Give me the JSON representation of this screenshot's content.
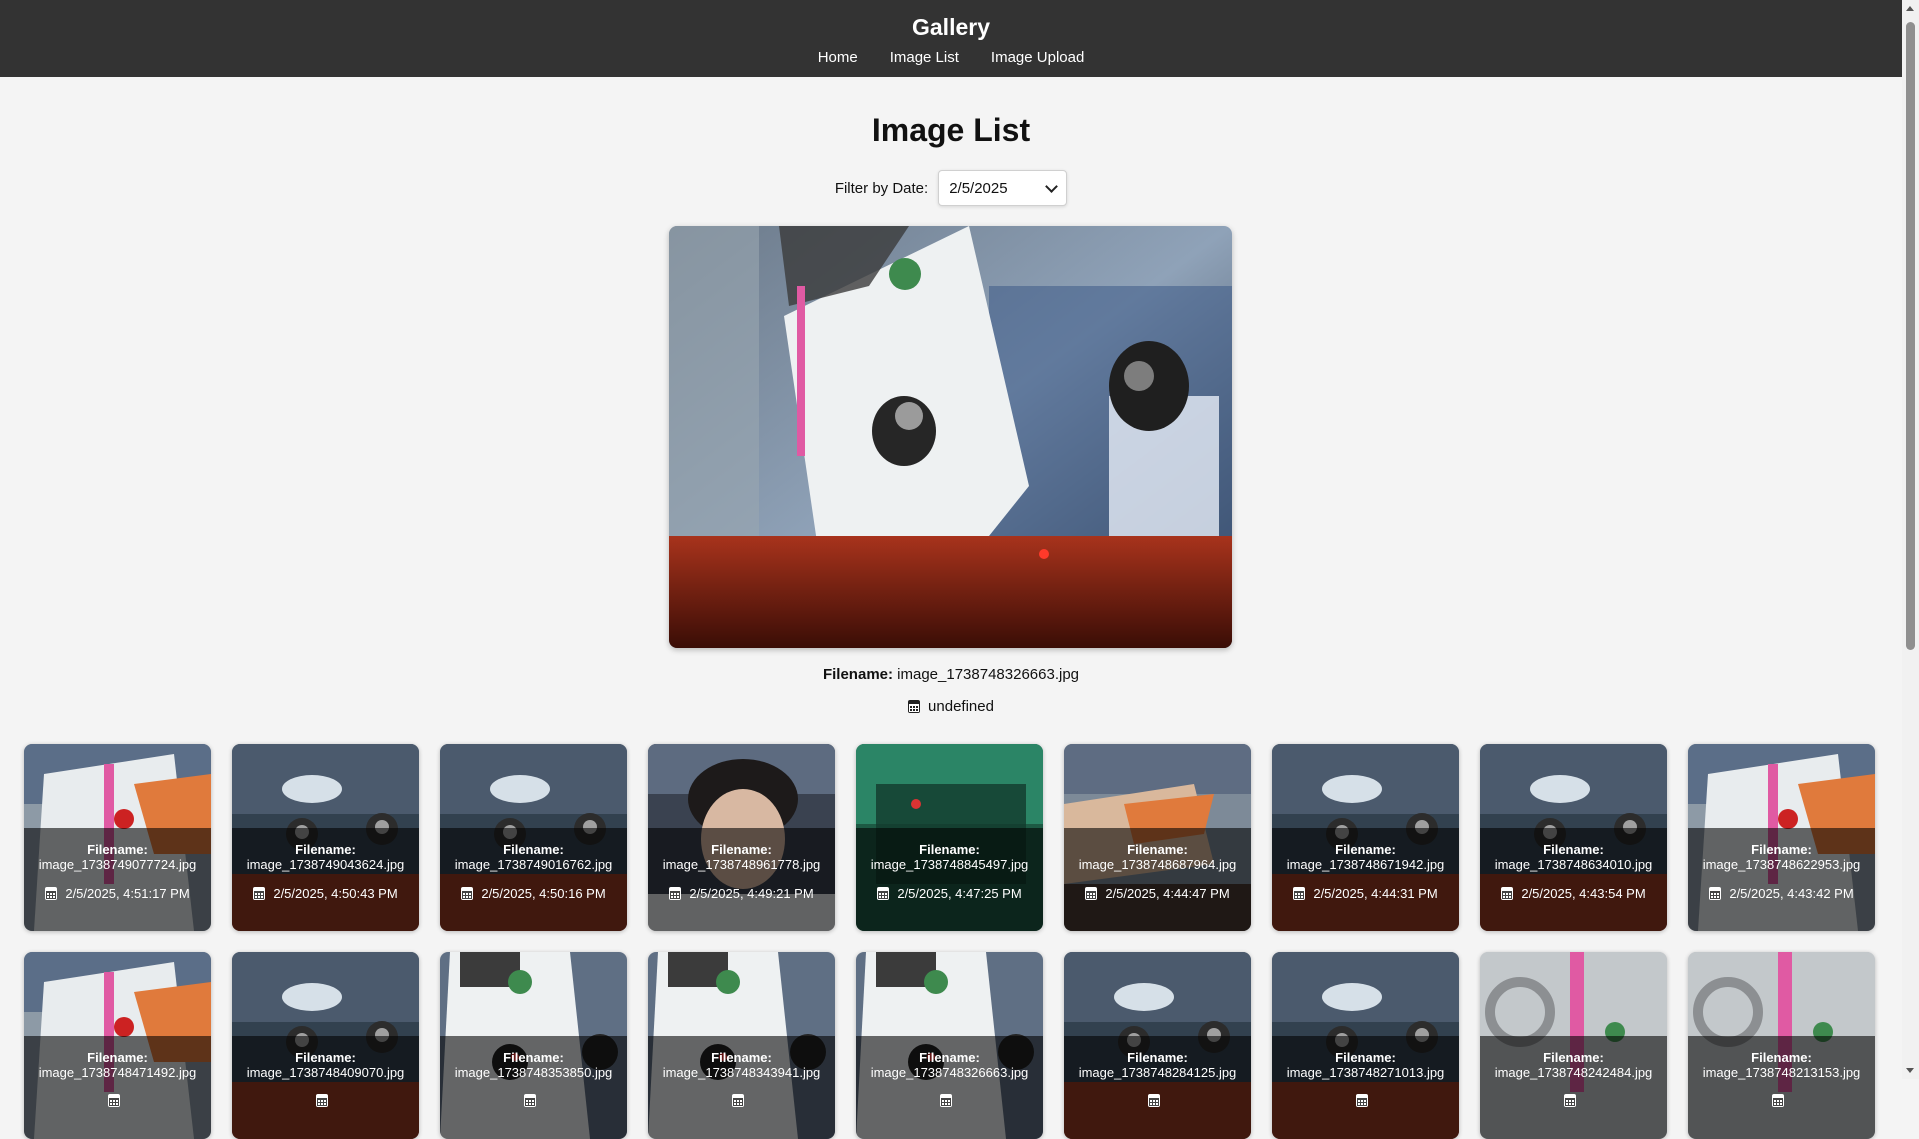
{
  "navbar": {
    "brand": "Gallery",
    "links": [
      {
        "label": "Home"
      },
      {
        "label": "Image List"
      },
      {
        "label": "Image Upload"
      }
    ]
  },
  "page_title": "Image List",
  "filter": {
    "label": "Filter by Date:",
    "selected": "2/5/2025"
  },
  "main_image": {
    "filename_label": "Filename:",
    "filename": "image_1738748326663.jpg",
    "date": "undefined"
  },
  "cards": [
    {
      "filename_label": "Filename:",
      "filename": "image_1738749077724.jpg",
      "date": "2/5/2025, 4:51:17 PM",
      "scene": "person"
    },
    {
      "filename_label": "Filename:",
      "filename": "image_1738749043624.jpg",
      "date": "2/5/2025, 4:50:43 PM",
      "scene": "store"
    },
    {
      "filename_label": "Filename:",
      "filename": "image_1738749016762.jpg",
      "date": "2/5/2025, 4:50:16 PM",
      "scene": "store"
    },
    {
      "filename_label": "Filename:",
      "filename": "image_1738748961778.jpg",
      "date": "2/5/2025, 4:49:21 PM",
      "scene": "face"
    },
    {
      "filename_label": "Filename:",
      "filename": "image_1738748845497.jpg",
      "date": "2/5/2025, 4:47:25 PM",
      "scene": "green"
    },
    {
      "filename_label": "Filename:",
      "filename": "image_1738748687964.jpg",
      "date": "2/5/2025, 4:44:47 PM",
      "scene": "arm"
    },
    {
      "filename_label": "Filename:",
      "filename": "image_1738748671942.jpg",
      "date": "2/5/2025, 4:44:31 PM",
      "scene": "store"
    },
    {
      "filename_label": "Filename:",
      "filename": "image_1738748634010.jpg",
      "date": "2/5/2025, 4:43:54 PM",
      "scene": "store"
    },
    {
      "filename_label": "Filename:",
      "filename": "image_1738748622953.jpg",
      "date": "2/5/2025, 4:43:42 PM",
      "scene": "person"
    },
    {
      "filename_label": "Filename:",
      "filename": "image_1738748471492.jpg",
      "date": "",
      "scene": "person"
    },
    {
      "filename_label": "Filename:",
      "filename": "image_1738748409070.jpg",
      "date": "",
      "scene": "store"
    },
    {
      "filename_label": "Filename:",
      "filename": "image_1738748353850.jpg",
      "date": "",
      "scene": "shirt"
    },
    {
      "filename_label": "Filename:",
      "filename": "image_1738748343941.jpg",
      "date": "",
      "scene": "shirt"
    },
    {
      "filename_label": "Filename:",
      "filename": "image_1738748326663.jpg",
      "date": "",
      "scene": "shirt"
    },
    {
      "filename_label": "Filename:",
      "filename": "image_1738748284125.jpg",
      "date": "",
      "scene": "store"
    },
    {
      "filename_label": "Filename:",
      "filename": "image_1738748271013.jpg",
      "date": "",
      "scene": "store"
    },
    {
      "filename_label": "Filename:",
      "filename": "image_1738748242484.jpg",
      "date": "",
      "scene": "lanyard"
    },
    {
      "filename_label": "Filename:",
      "filename": "image_1738748213153.jpg",
      "date": "",
      "scene": "lanyard"
    }
  ],
  "colors": {
    "navbar_bg": "#333333",
    "page_bg": "#f4f4f4",
    "overlay_bg": "rgba(0,0,0,0.58)"
  },
  "icons": {
    "date": "calendar-icon",
    "select": "chevron-down-icon"
  }
}
